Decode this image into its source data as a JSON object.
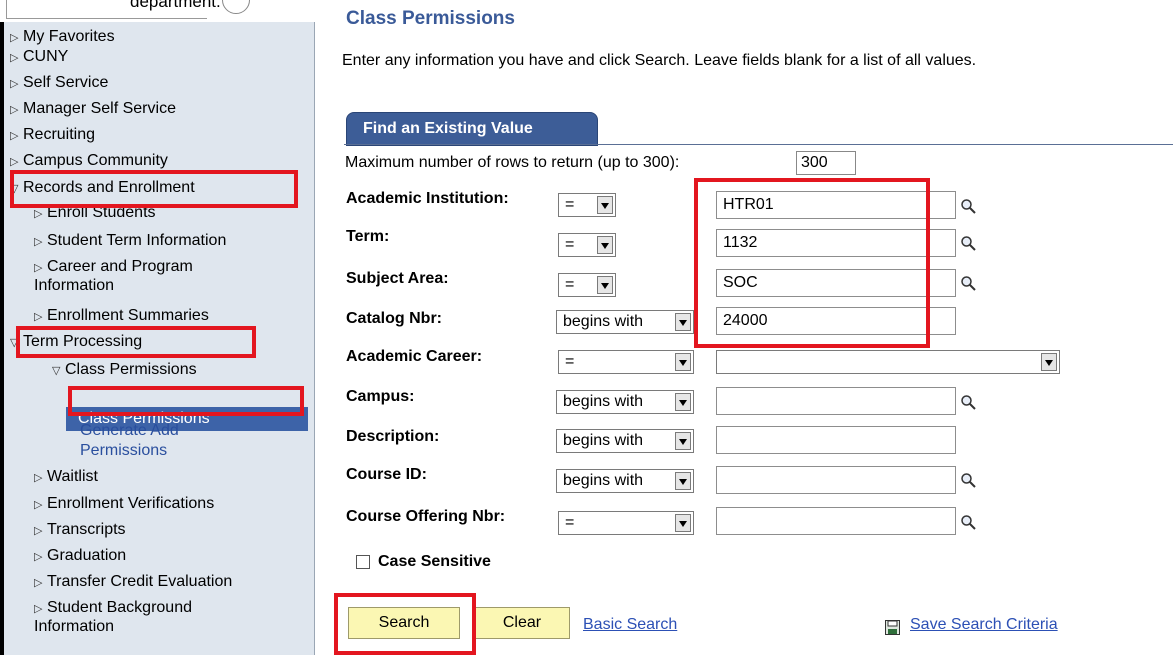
{
  "caption": "department.",
  "sidebar": {
    "items": [
      {
        "label": "My Favorites"
      },
      {
        "label": "CUNY"
      },
      {
        "label": "Self Service"
      },
      {
        "label": "Manager Self Service"
      },
      {
        "label": "Recruiting"
      },
      {
        "label": "Campus Community"
      },
      {
        "label": "Records and Enrollment"
      },
      {
        "label": "Enroll Students"
      },
      {
        "label": "Student Term Information"
      },
      {
        "label": "Career and Program Information"
      },
      {
        "label": "Enrollment Summaries"
      },
      {
        "label": "Term Processing"
      },
      {
        "label": "Class Permissions"
      },
      {
        "label": "Class Permissions"
      },
      {
        "label": "Generate Add Permissions"
      },
      {
        "label": "Waitlist"
      },
      {
        "label": "Enrollment Verifications"
      },
      {
        "label": "Transcripts"
      },
      {
        "label": "Graduation"
      },
      {
        "label": "Transfer Credit Evaluation"
      },
      {
        "label": "Student Background Information"
      }
    ]
  },
  "main": {
    "title": "Class Permissions",
    "instructions": "Enter any information you have and click Search. Leave fields blank for a list of all values.",
    "tab_label": "Find an Existing Value",
    "max_rows_label": "Maximum number of rows to return (up to 300):",
    "max_rows_value": "300",
    "fields": [
      {
        "label": "Academic Institution:",
        "operator": "=",
        "value": "HTR01"
      },
      {
        "label": "Term:",
        "operator": "=",
        "value": "1132"
      },
      {
        "label": "Subject Area:",
        "operator": "=",
        "value": "SOC"
      },
      {
        "label": "Catalog Nbr:",
        "operator": "begins with",
        "value": "24000"
      },
      {
        "label": "Academic Career:",
        "operator": "=",
        "value": ""
      },
      {
        "label": "Campus:",
        "operator": "begins with",
        "value": ""
      },
      {
        "label": "Description:",
        "operator": "begins with",
        "value": ""
      },
      {
        "label": "Course ID:",
        "operator": "begins with",
        "value": ""
      },
      {
        "label": "Course Offering Nbr:",
        "operator": "=",
        "value": ""
      }
    ],
    "case_sensitive_label": "Case Sensitive",
    "search_label": "Search",
    "clear_label": "Clear",
    "basic_search_label": "Basic Search",
    "save_criteria_label": "Save Search Criteria"
  },
  "colors": {
    "highlight": "#e3161f",
    "title": "#3a5a98",
    "tab": "#3d5d97",
    "selected_nav": "#3d63a8",
    "button": "#fbf7b3",
    "sidebar": "#dfe6ee",
    "link": "#2c50b5"
  },
  "icons": [
    "triangle-right-icon",
    "triangle-down-icon",
    "lookup-magnifier-icon",
    "dropdown-arrow-icon",
    "save-disk-icon"
  ]
}
